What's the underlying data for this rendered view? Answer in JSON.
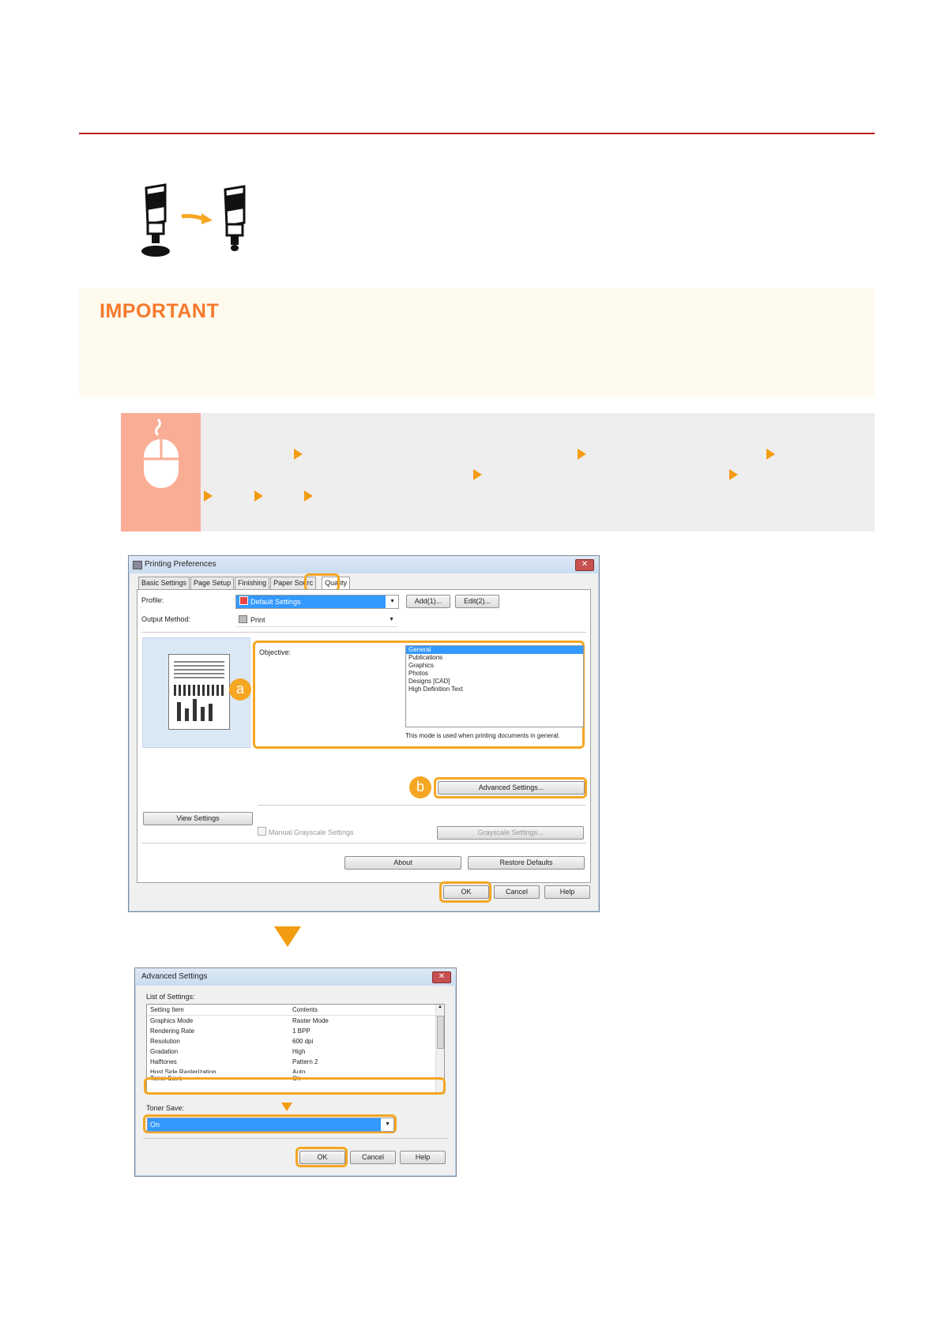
{
  "important": {
    "title": "IMPORTANT"
  },
  "dialog1": {
    "title": "Printing Preferences",
    "close": "✕",
    "tabs": [
      "Basic Settings",
      "Page Setup",
      "Finishing",
      "Paper Sourc",
      "Quality"
    ],
    "profile_label": "Profile:",
    "profile_value": "Default Settings",
    "add_button": "Add(1)...",
    "edit_button": "Edit(2)...",
    "output_label": "Output Method:",
    "output_value": "Print",
    "objective_label": "Objective:",
    "objective_items": [
      "General",
      "Publications",
      "Graphics",
      "Photos",
      "Designs [CAD]",
      "High Definition Text"
    ],
    "objective_description": "This mode is used when printing documents in general.",
    "badge_a": "a",
    "badge_b": "b",
    "advanced_button": "Advanced Settings...",
    "view_settings_button": "View Settings",
    "manual_grayscale_label": "Manual Grayscale Settings",
    "grayscale_button": "Grayscale Settings...",
    "about_button": "About",
    "restore_button": "Restore Defaults",
    "ok_button": "OK",
    "cancel_button": "Cancel",
    "help_button": "Help"
  },
  "dialog2": {
    "title": "Advanced Settings",
    "close": "✕",
    "list_label": "List of Settings:",
    "col_item": "Setting Item",
    "col_contents": "Contents",
    "rows": [
      {
        "item": "Graphics Mode",
        "value": "Raster Mode"
      },
      {
        "item": "Rendering Rate",
        "value": "1 BPP"
      },
      {
        "item": "Resolution",
        "value": "600 dpi"
      },
      {
        "item": "Gradation",
        "value": "High"
      },
      {
        "item": "Halftones",
        "value": "Pattern 2"
      },
      {
        "item": "Host Side Rasterization",
        "value": "Auto"
      },
      {
        "item": "Toner Save",
        "value": "On"
      }
    ],
    "toner_label": "Toner Save:",
    "toner_value": "On",
    "ok_button": "OK",
    "cancel_button": "Cancel",
    "help_button": "Help"
  }
}
